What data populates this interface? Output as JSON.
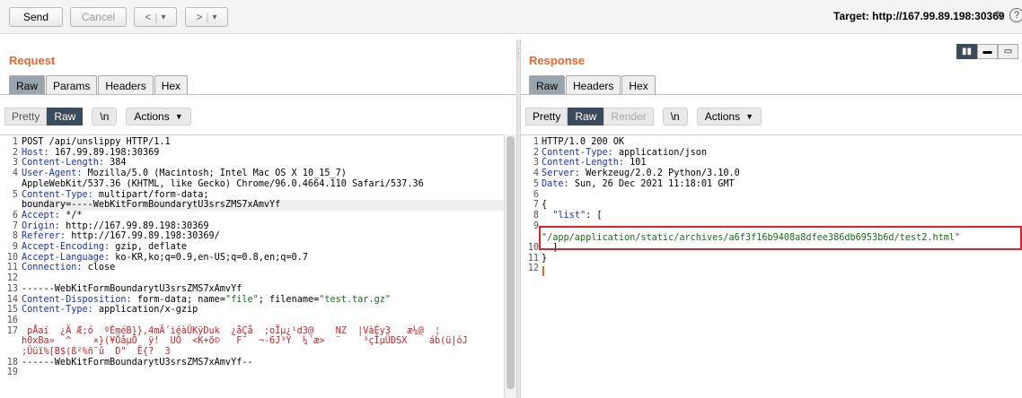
{
  "toolbar": {
    "send": "Send",
    "cancel": "Cancel",
    "back": "<",
    "forward": ">",
    "dropdown": "▾",
    "target_label": "Target: http://167.99.89.198:30369"
  },
  "request": {
    "title": "Request",
    "tabs": [
      "Raw",
      "Params",
      "Headers",
      "Hex"
    ],
    "active_tab": "Raw",
    "pretty": "Pretty",
    "raw": "Raw",
    "newline": "\\n",
    "actions": "Actions",
    "gutter": [
      "1",
      "2",
      "3",
      "4",
      "",
      "5",
      "",
      "6",
      "7",
      "8",
      "9",
      "10",
      "11",
      "12",
      "13",
      "14",
      "15",
      "16",
      "17",
      "",
      "",
      "18",
      "19"
    ],
    "lines": [
      {
        "parts": [
          {
            "t": "POST /api/unslippy HTTP/1.1",
            "c": ""
          }
        ]
      },
      {
        "parts": [
          {
            "t": "Host: ",
            "c": "key"
          },
          {
            "t": "167.99.89.198:30369",
            "c": ""
          }
        ]
      },
      {
        "parts": [
          {
            "t": "Content-Length: ",
            "c": "key"
          },
          {
            "t": "384",
            "c": ""
          }
        ]
      },
      {
        "parts": [
          {
            "t": "User-Agent: ",
            "c": "key"
          },
          {
            "t": "Mozilla/5.0 (Macintosh; Intel Mac OS X 10_15_7)",
            "c": ""
          }
        ]
      },
      {
        "parts": [
          {
            "t": "AppleWebKit/537.36 (KHTML, like Gecko) Chrome/96.0.4664.110 Safari/537.36",
            "c": ""
          }
        ]
      },
      {
        "parts": [
          {
            "t": "Content-Type: ",
            "c": "key"
          },
          {
            "t": "multipart/form-data;",
            "c": ""
          }
        ]
      },
      {
        "parts": [
          {
            "t": "boundary=----WebKitFormBoundarytU3srsZMS7xAmvYf",
            "c": ""
          }
        ],
        "bg": true
      },
      {
        "parts": [
          {
            "t": "Accept: ",
            "c": "key"
          },
          {
            "t": "*/*",
            "c": ""
          }
        ]
      },
      {
        "parts": [
          {
            "t": "Origin: ",
            "c": "key"
          },
          {
            "t": "http://167.99.89.198:30369",
            "c": ""
          }
        ]
      },
      {
        "parts": [
          {
            "t": "Referer: ",
            "c": "key"
          },
          {
            "t": "http://167.99.89.198:30369/",
            "c": ""
          }
        ]
      },
      {
        "parts": [
          {
            "t": "Accept-Encoding: ",
            "c": "key"
          },
          {
            "t": "gzip, deflate",
            "c": ""
          }
        ]
      },
      {
        "parts": [
          {
            "t": "Accept-Language: ",
            "c": "key"
          },
          {
            "t": "ko-KR,ko;q=0.9,en-US;q=0.8,en;q=0.7",
            "c": ""
          }
        ]
      },
      {
        "parts": [
          {
            "t": "Connection: ",
            "c": "key"
          },
          {
            "t": "close",
            "c": ""
          }
        ]
      },
      {
        "parts": [
          {
            "t": "",
            "c": ""
          }
        ]
      },
      {
        "parts": [
          {
            "t": "------WebKitFormBoundarytU3srsZMS7xAmvYf",
            "c": ""
          }
        ]
      },
      {
        "parts": [
          {
            "t": "Content-Disposition: ",
            "c": "key"
          },
          {
            "t": "form-data; name=",
            "c": ""
          },
          {
            "t": "\"file\"",
            "c": "str"
          },
          {
            "t": "; filename=",
            "c": ""
          },
          {
            "t": "\"test.tar.gz\"",
            "c": "str"
          }
        ]
      },
      {
        "parts": [
          {
            "t": "Content-Type: ",
            "c": "key"
          },
          {
            "t": "application/x-gzip",
            "c": ""
          }
        ]
      },
      {
        "parts": [
          {
            "t": "",
            "c": ""
          }
        ]
      },
      {
        "parts": [
          {
            "t": " pÅaí  ¿Ä Æ;ó  ºÈméB}},4mÄ´iéàÜKÿDuk  ¿åÇå  ;oÏµ¿¹d3@    NZ  |VàÉy3   æ¼@  ¦",
            "c": "bin"
          }
        ]
      },
      {
        "parts": [
          {
            "t": "h0xBa»  ^    ×}(¥ÖåµÖ  ÿ!  UÕ  <K+õ©   F¯  ¬-6J³Y  ¼´æ>  ¨    ³çÎµÜÐSX    áb(ü|óJ",
            "c": "bin"
          }
        ]
      },
      {
        "parts": [
          {
            "t": ";Ûüï%[B$(ß²%ñ¯û  D\"  Ë{?  3",
            "c": "bin"
          }
        ]
      },
      {
        "parts": [
          {
            "t": "------WebKitFormBoundarytU3srsZMS7xAmvYf--",
            "c": ""
          }
        ]
      },
      {
        "parts": [
          {
            "t": "",
            "c": ""
          }
        ]
      }
    ]
  },
  "response": {
    "title": "Response",
    "tabs": [
      "Raw",
      "Headers",
      "Hex"
    ],
    "active_tab": "Raw",
    "pretty": "Pretty",
    "raw": "Raw",
    "render": "Render",
    "newline": "\\n",
    "actions": "Actions",
    "gutter": [
      "1",
      "2",
      "3",
      "4",
      "5",
      "6",
      "7",
      "8",
      "9",
      "",
      "10",
      "11",
      "12"
    ],
    "lines": [
      {
        "parts": [
          {
            "t": "HTTP/1.0 200 OK",
            "c": ""
          }
        ]
      },
      {
        "parts": [
          {
            "t": "Content-Type: ",
            "c": "key"
          },
          {
            "t": "application/json",
            "c": ""
          }
        ]
      },
      {
        "parts": [
          {
            "t": "Content-Length: ",
            "c": "key"
          },
          {
            "t": "101",
            "c": ""
          }
        ]
      },
      {
        "parts": [
          {
            "t": "Server: ",
            "c": "key"
          },
          {
            "t": "Werkzeug/2.0.2 Python/3.10.0",
            "c": ""
          }
        ]
      },
      {
        "parts": [
          {
            "t": "Date: ",
            "c": "key"
          },
          {
            "t": "Sun, 26 Dec 2021 11:18:01 GMT",
            "c": ""
          }
        ]
      },
      {
        "parts": [
          {
            "t": "",
            "c": ""
          }
        ]
      },
      {
        "parts": [
          {
            "t": "{",
            "c": ""
          }
        ]
      },
      {
        "parts": [
          {
            "t": "  ",
            "c": ""
          },
          {
            "t": "\"list\"",
            "c": "key"
          },
          {
            "t": ": [",
            "c": ""
          }
        ]
      },
      {
        "parts": [
          {
            "t": "",
            "c": ""
          }
        ]
      },
      {
        "parts": [
          {
            "t": "\"/app/application/static/archives/a6f3f16b9408a8dfee386db6953b6d/test2.html\"",
            "c": "str"
          }
        ]
      },
      {
        "parts": [
          {
            "t": "  ]",
            "c": ""
          }
        ]
      },
      {
        "parts": [
          {
            "t": "}",
            "c": ""
          }
        ]
      },
      {
        "parts": [
          {
            "t": "",
            "c": ""
          }
        ],
        "bg": true
      }
    ]
  }
}
